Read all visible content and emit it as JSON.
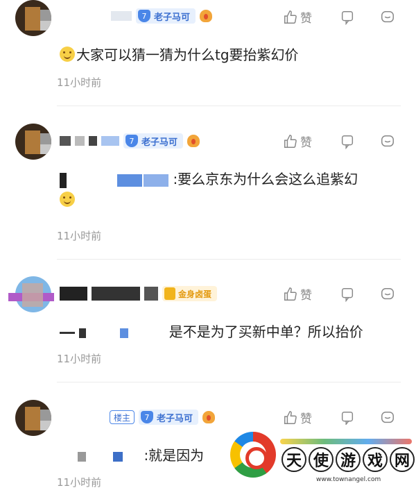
{
  "comments": [
    {
      "level": "7",
      "title": "老子马可",
      "like_label": "赞",
      "text": "大家可以猜一猜为什么tg要抬紫幻价",
      "time": "11小时前"
    },
    {
      "level": "7",
      "title": "老子马可",
      "like_label": "赞",
      "text": ":要么京东为什么会这么追紫幻",
      "time": "11小时前"
    },
    {
      "badge": "金身卤蛋",
      "like_label": "赞",
      "text": "是不是为了买新中单？所以抬价",
      "time": "11小时前"
    },
    {
      "owner_tag": "楼主",
      "level": "7",
      "title": "老子马可",
      "like_label": "赞",
      "text": ":就是因为",
      "time": "11小时前"
    }
  ],
  "watermark": {
    "chars": [
      "天",
      "使",
      "游",
      "戏",
      "网"
    ],
    "url": "www.townangel.com"
  },
  "colors": {
    "level_blue": "#4a86e8",
    "gold": "#f1b41c",
    "muted": "#999999"
  }
}
